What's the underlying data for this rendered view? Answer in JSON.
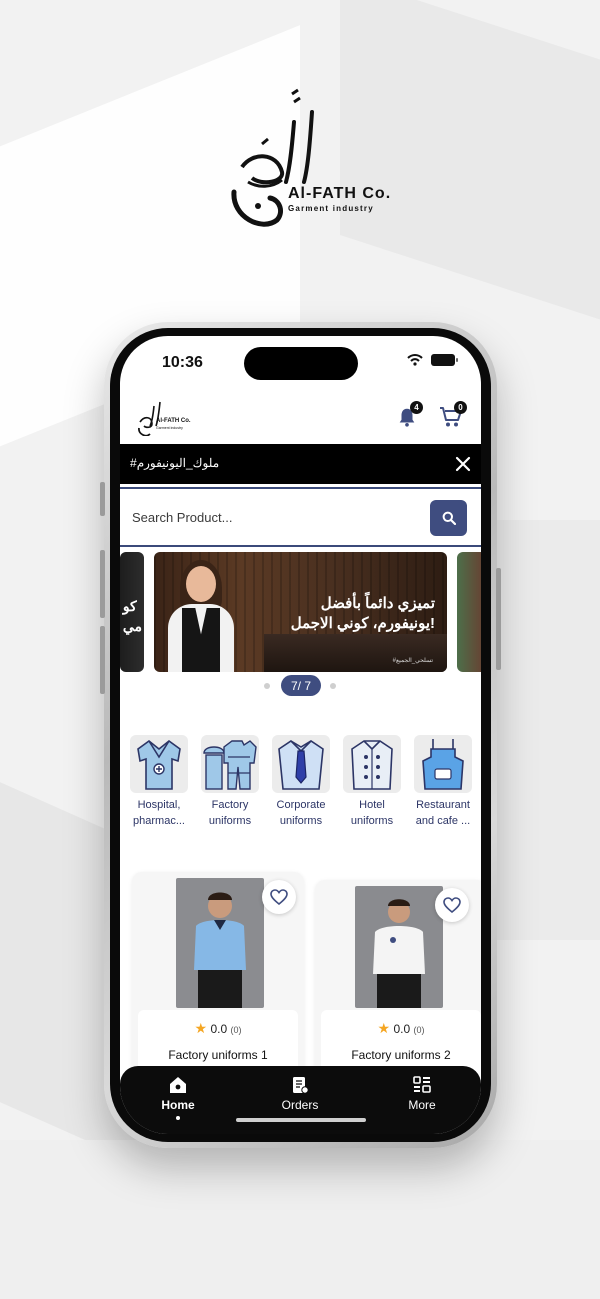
{
  "brand": {
    "name": "Al-FATH Co.",
    "subtitle": "Garment industry",
    "arabic_logo": "الفتح"
  },
  "status_bar": {
    "time": "10:36"
  },
  "header": {
    "logo_name": "Al-FATH Co.",
    "logo_sub": "Garment industry",
    "notifications_count": "4",
    "cart_count": "0"
  },
  "announcement": {
    "text": "#ملوك_اليونيفورم"
  },
  "search": {
    "placeholder": "Search Product..."
  },
  "carousel": {
    "left_slide_text": "كو\nمي",
    "main_slide_text_line1": "تميزي دائماً بأفضل",
    "main_slide_text_line2": "يونيفورم، كوني الاجمل!",
    "main_slide_tag": "#تسلحي_الجميع",
    "pager": "7/ 7"
  },
  "categories": [
    {
      "label": "Hospital, pharmac...",
      "icon": "scrubs-icon"
    },
    {
      "label": "Factory uniforms",
      "icon": "coverall-icon"
    },
    {
      "label": "Corporate uniforms",
      "icon": "shirt-tie-icon"
    },
    {
      "label": "Hotel uniforms",
      "icon": "chef-jacket-icon"
    },
    {
      "label": "Restaurant and cafe ...",
      "icon": "apron-icon"
    }
  ],
  "products": [
    {
      "name": "Factory uniforms 1",
      "rating": "0.0",
      "reviews": "(0)"
    },
    {
      "name": "Factory uniforms 2",
      "rating": "0.0",
      "reviews": "(0)"
    }
  ],
  "tabbar": {
    "home": "Home",
    "orders": "Orders",
    "more": "More"
  },
  "colors": {
    "accent": "#3f4d80",
    "category_text": "#2c3566",
    "star": "#f5a623",
    "black": "#000000"
  }
}
